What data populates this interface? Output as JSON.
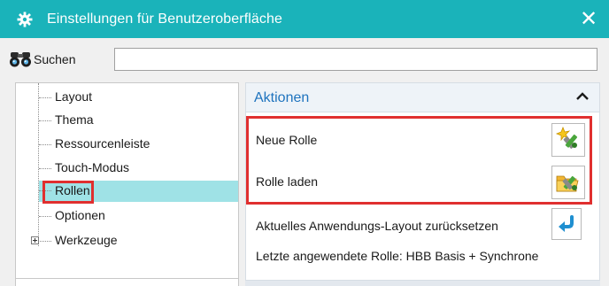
{
  "window": {
    "title": "Einstellungen für Benutzeroberfläche",
    "close_glyph": "✕",
    "icons": {
      "app": "gear-icon",
      "close": "close-icon"
    },
    "accent_color": "#1ab3ba"
  },
  "search": {
    "label": "Suchen",
    "value": "",
    "placeholder": "",
    "icon": "binoculars-icon"
  },
  "tree": {
    "items": [
      {
        "label": "Layout"
      },
      {
        "label": "Thema"
      },
      {
        "label": "Ressourcenleiste"
      },
      {
        "label": "Touch-Modus"
      },
      {
        "label": "Rollen",
        "selected": true
      },
      {
        "label": "Optionen"
      },
      {
        "label": "Werkzeuge",
        "expandable": true
      }
    ],
    "selection_color": "#9fe2e6",
    "highlight_color": "#e02f2f"
  },
  "panel": {
    "title": "Aktionen",
    "collapse_icon": "chevron-up-icon",
    "title_color": "#1e73be",
    "rows": [
      {
        "label": "Neue Rolle",
        "icon": "new-role-icon"
      },
      {
        "label": "Rolle laden",
        "icon": "load-role-icon"
      },
      {
        "label": "Aktuelles Anwendungs-Layout zurücksetzen",
        "icon": "reset-arrow-icon"
      },
      {
        "label": "Letzte angewendete Rolle: HBB Basis + Synchrone"
      }
    ]
  }
}
